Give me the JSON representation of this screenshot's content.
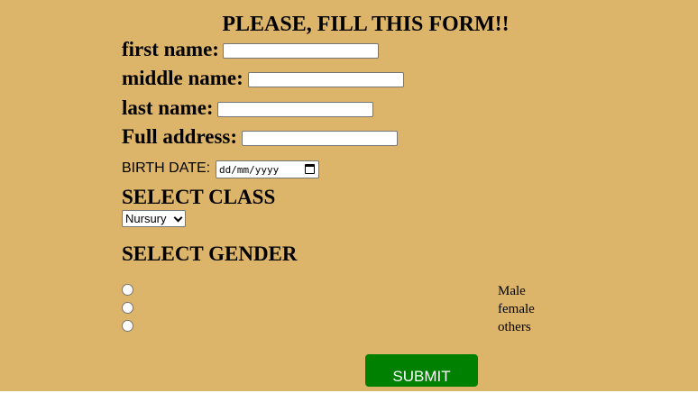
{
  "form": {
    "title": "PLEASE, FILL THIS FORM!!",
    "fields": {
      "first_name_label": "first name:",
      "middle_name_label": "middle name:",
      "last_name_label": "last name:",
      "address_label": "Full address:"
    },
    "birth_date_label": "BIRTH DATE:",
    "birth_date_placeholder": "dd/mm/yyyy",
    "class_heading": "SELECT CLASS",
    "class_selected": "Nursury",
    "gender_heading": "SELECT GENDER",
    "gender_options": [
      "Male",
      "female",
      "others"
    ],
    "submit_label": "SUBMIT"
  },
  "colors": {
    "background": "#dcb46a",
    "submit_button": "#008000"
  },
  "icons": {
    "date_picker": "calendar-icon",
    "select_arrow": "chevron-down-icon"
  }
}
